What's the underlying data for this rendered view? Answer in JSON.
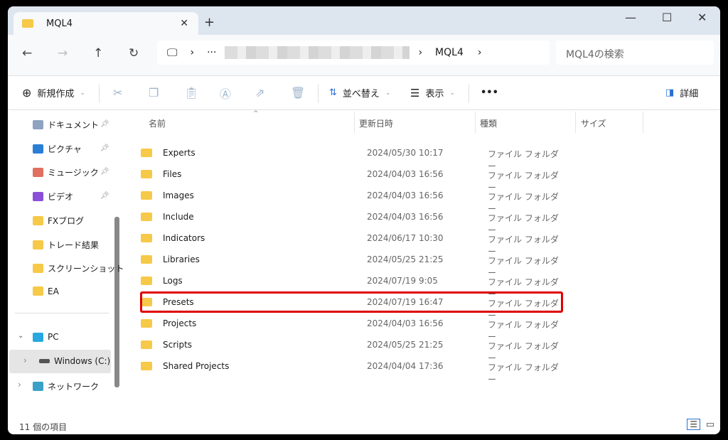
{
  "window": {
    "tab_title": "MQL4",
    "search_placeholder": "MQL4の検索"
  },
  "address": {
    "current": "MQL4"
  },
  "toolbar": {
    "new": "新規作成",
    "sort": "並べ替え",
    "view": "表示",
    "more": "•••",
    "details": "詳細"
  },
  "sidebar": {
    "items": [
      {
        "label": "ドキュメント",
        "icon": "document-icon",
        "color": "#8fa3c0",
        "pinned": true
      },
      {
        "label": "ピクチャ",
        "icon": "picture-icon",
        "color": "#2a7fd4",
        "pinned": true
      },
      {
        "label": "ミュージック",
        "icon": "music-icon",
        "color": "#e07060",
        "pinned": true
      },
      {
        "label": "ビデオ",
        "icon": "video-icon",
        "color": "#8a4fd8",
        "pinned": true
      },
      {
        "label": "FXブログ",
        "icon": "folder-icon",
        "color": "#f7c948"
      },
      {
        "label": "トレード結果",
        "icon": "folder-icon",
        "color": "#f7c948"
      },
      {
        "label": "スクリーンショット",
        "icon": "folder-icon",
        "color": "#f7c948"
      },
      {
        "label": "EA",
        "icon": "folder-icon",
        "color": "#f7c948"
      }
    ],
    "pc": "PC",
    "drive": "Windows (C:)",
    "network": "ネットワーク"
  },
  "columns": {
    "name": "名前",
    "date": "更新日時",
    "type": "種類",
    "size": "サイズ"
  },
  "files": [
    {
      "name": "Experts",
      "date": "2024/05/30 10:17",
      "type": "ファイル フォルダー"
    },
    {
      "name": "Files",
      "date": "2024/04/03 16:56",
      "type": "ファイル フォルダー"
    },
    {
      "name": "Images",
      "date": "2024/04/03 16:56",
      "type": "ファイル フォルダー"
    },
    {
      "name": "Include",
      "date": "2024/04/03 16:56",
      "type": "ファイル フォルダー"
    },
    {
      "name": "Indicators",
      "date": "2024/06/17 10:30",
      "type": "ファイル フォルダー"
    },
    {
      "name": "Libraries",
      "date": "2024/05/25 21:25",
      "type": "ファイル フォルダー"
    },
    {
      "name": "Logs",
      "date": "2024/07/19 9:05",
      "type": "ファイル フォルダー"
    },
    {
      "name": "Presets",
      "date": "2024/07/19 16:47",
      "type": "ファイル フォルダー",
      "highlighted": true
    },
    {
      "name": "Projects",
      "date": "2024/04/03 16:56",
      "type": "ファイル フォルダー"
    },
    {
      "name": "Scripts",
      "date": "2024/05/25 21:25",
      "type": "ファイル フォルダー"
    },
    {
      "name": "Shared Projects",
      "date": "2024/04/04 17:36",
      "type": "ファイル フォルダー"
    }
  ],
  "status": {
    "count": "11 個の項目"
  },
  "colors": {
    "highlight": "#e00000",
    "folder": "#f7c948"
  }
}
